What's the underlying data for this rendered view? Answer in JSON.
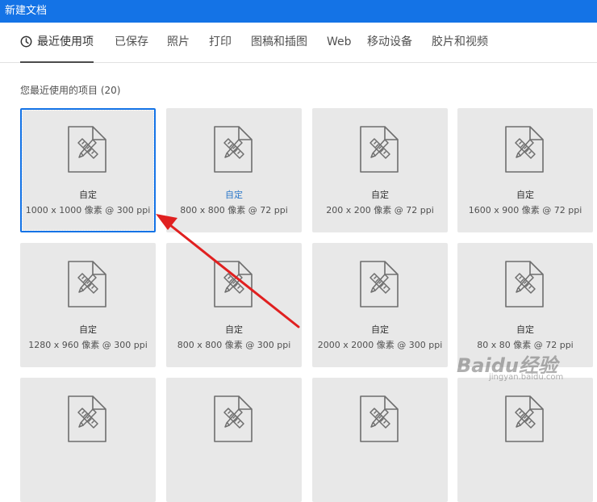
{
  "window": {
    "title": "新建文档"
  },
  "tabs": [
    {
      "label": "最近使用项",
      "active": true,
      "icon": "clock-icon"
    },
    {
      "label": "已保存"
    },
    {
      "label": "照片"
    },
    {
      "label": "打印"
    },
    {
      "label": "图稿和插图"
    },
    {
      "label": "Web"
    },
    {
      "label": "移动设备"
    },
    {
      "label": "胶片和视频"
    }
  ],
  "recent": {
    "label": "您最近使用的项目",
    "count": "(20)",
    "items": [
      {
        "name": "自定",
        "size": "1000 x 1000 像素 @ 300 ppi",
        "selected": true
      },
      {
        "name": "自定",
        "size": "800 x 800 像素 @ 72 ppi",
        "highlighted": true
      },
      {
        "name": "自定",
        "size": "200 x 200 像素 @ 72 ppi"
      },
      {
        "name": "自定",
        "size": "1600 x 900 像素 @ 72 ppi"
      },
      {
        "name": "自定",
        "size": "1280 x 960 像素 @ 300 ppi"
      },
      {
        "name": "自定",
        "size": "800 x 800 像素 @ 300 ppi"
      },
      {
        "name": "自定",
        "size": "2000 x 2000 像素 @ 300 ppi"
      },
      {
        "name": "自定",
        "size": "80 x 80 像素 @ 72 ppi"
      },
      {
        "name": "",
        "size": ""
      },
      {
        "name": "",
        "size": ""
      },
      {
        "name": "",
        "size": ""
      },
      {
        "name": "",
        "size": ""
      }
    ]
  },
  "colors": {
    "accent": "#1473e6",
    "card": "#e8e8e8",
    "annotation_arrow": "#e02020"
  },
  "watermark": {
    "text": "Baidu经验",
    "sub": "jingyan.baidu.com"
  }
}
